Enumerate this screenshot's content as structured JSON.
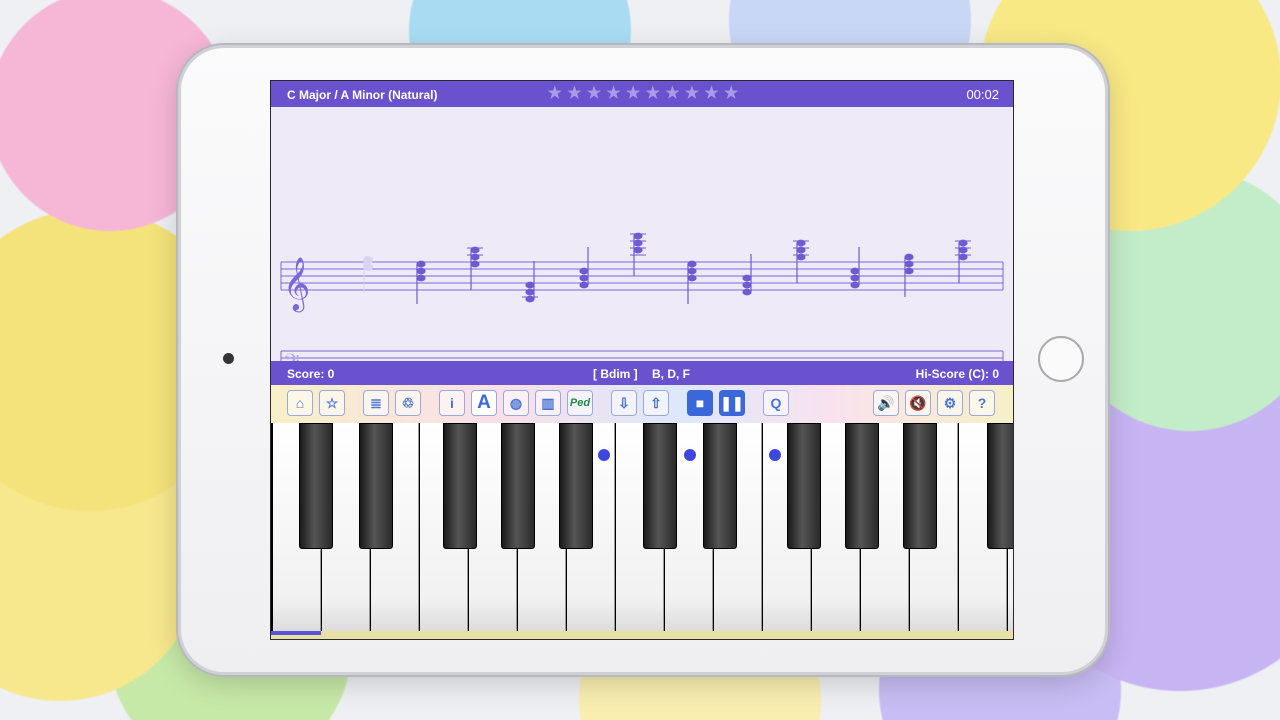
{
  "header": {
    "title": "C Major  /  A Minor (Natural)",
    "timer": "00:02",
    "stars_total": 10,
    "stars_earned": 0
  },
  "status": {
    "score": "Score: 0",
    "chord": "[ Bdim ]",
    "chord_notes": "B, D, F",
    "hiscore": "Hi-Score (C): 0"
  },
  "colors": {
    "bar": "#6a52cf",
    "notes": "#6f5bd0",
    "key_dot": "#3d47e0"
  },
  "toolbar": {
    "buttons": [
      {
        "name": "home-icon",
        "glyph": "⌂"
      },
      {
        "name": "star-icon",
        "glyph": "☆"
      },
      {
        "name": "list-icon",
        "glyph": "≣"
      },
      {
        "name": "recycle-icon",
        "glyph": "♲"
      },
      {
        "name": "info-icon",
        "glyph": "i"
      },
      {
        "name": "letter-a-icon",
        "glyph": "A"
      },
      {
        "name": "palette-icon",
        "glyph": "◍"
      },
      {
        "name": "piano-icon",
        "glyph": "▥"
      },
      {
        "name": "pedal-icon",
        "glyph": "Ped"
      },
      {
        "name": "arrow-down-icon",
        "glyph": "⇩"
      },
      {
        "name": "arrow-up-icon",
        "glyph": "⇧"
      },
      {
        "name": "stop-icon",
        "glyph": "■"
      },
      {
        "name": "pause-icon",
        "glyph": "❚❚"
      },
      {
        "name": "q-icon",
        "glyph": "Q"
      },
      {
        "name": "speaker-icon",
        "glyph": "🔊"
      },
      {
        "name": "mute-icon",
        "glyph": "🔇"
      },
      {
        "name": "gear-icon",
        "glyph": "⚙"
      },
      {
        "name": "help-icon",
        "glyph": "?"
      }
    ]
  }
}
